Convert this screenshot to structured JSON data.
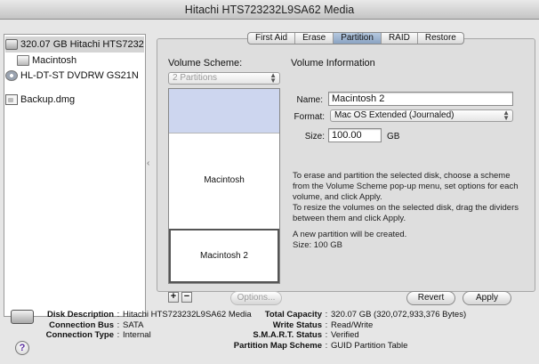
{
  "window": {
    "title": "Hitachi HTS723232L9SA62 Media"
  },
  "sidebar": {
    "items": [
      {
        "label": "320.07 GB Hitachi HTS723232...",
        "icon": "hard-disk-icon"
      },
      {
        "label": "Macintosh",
        "icon": "volume-icon"
      },
      {
        "label": "HL-DT-ST DVDRW GS21N",
        "icon": "optical-drive-icon"
      },
      {
        "label": "Backup.dmg",
        "icon": "disk-image-icon"
      }
    ]
  },
  "tabs": [
    {
      "label": "First Aid"
    },
    {
      "label": "Erase"
    },
    {
      "label": "Partition"
    },
    {
      "label": "RAID"
    },
    {
      "label": "Restore"
    }
  ],
  "volume_scheme": {
    "title": "Volume Scheme:",
    "popup_value": "2 Partitions",
    "partitions": [
      {
        "label": ""
      },
      {
        "label": "Macintosh"
      },
      {
        "label": "Macintosh 2"
      }
    ],
    "add_label": "+",
    "remove_label": "−",
    "options_label": "Options..."
  },
  "volume_info": {
    "title": "Volume Information",
    "name_label": "Name:",
    "name_value": "Macintosh 2",
    "format_label": "Format:",
    "format_value": "Mac OS Extended (Journaled)",
    "size_label": "Size:",
    "size_value": "100.00",
    "size_unit": "GB",
    "instructions": [
      "To erase and partition the selected disk, choose a scheme from the Volume Scheme pop-up menu, set options for each volume, and click Apply.",
      "To resize the volumes on the selected disk, drag the dividers between them and click Apply.",
      "A new partition will be created.",
      "Size: 100 GB"
    ]
  },
  "buttons": {
    "revert": "Revert",
    "apply": "Apply"
  },
  "disk_info": {
    "left": [
      {
        "key": "Disk Description",
        "value": "Hitachi HTS723232L9SA62 Media"
      },
      {
        "key": "Connection Bus",
        "value": "SATA"
      },
      {
        "key": "Connection Type",
        "value": "Internal"
      }
    ],
    "right": [
      {
        "key": "Total Capacity",
        "value": "320.07 GB (320,072,933,376 Bytes)"
      },
      {
        "key": "Write Status",
        "value": "Read/Write"
      },
      {
        "key": "S.M.A.R.T. Status",
        "value": "Verified"
      },
      {
        "key": "Partition Map Scheme",
        "value": "GUID Partition Table"
      }
    ]
  },
  "help_label": "?",
  "colors": {
    "selected_partition": "#cdd6ef",
    "active_tab": "#9fb6d3"
  }
}
